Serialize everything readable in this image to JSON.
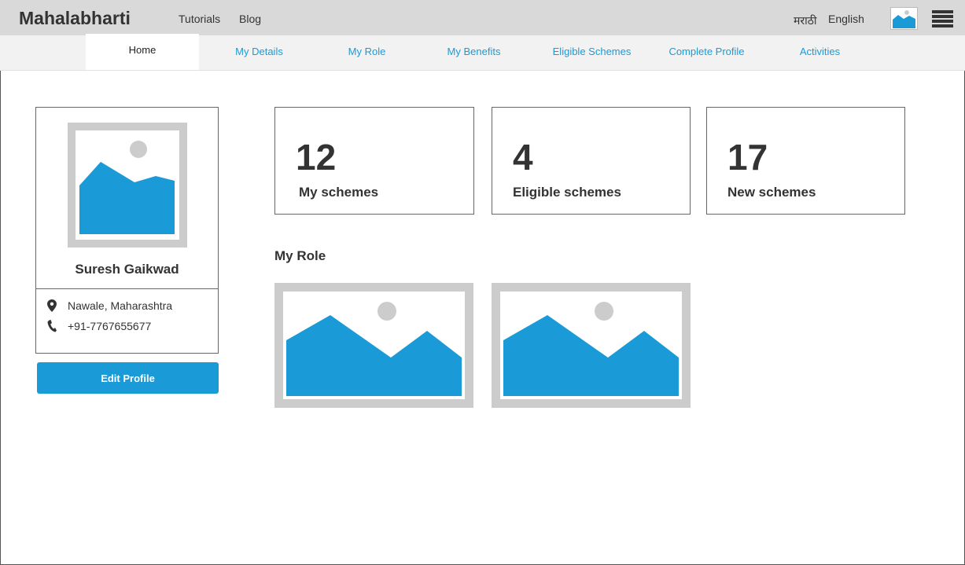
{
  "header": {
    "brand": "Mahalabharti",
    "links": [
      "Tutorials",
      "Blog"
    ],
    "languages": [
      "मराठी",
      "English"
    ],
    "avatar_icon": "image-placeholder-icon",
    "menu_icon": "hamburger-menu-icon"
  },
  "nav": {
    "tabs": [
      "Home",
      "My Details",
      "My Role",
      "My Benefits",
      "Eligible Schemes",
      "Complete Profile",
      "Activities"
    ],
    "active": "Home"
  },
  "profile": {
    "name": "Suresh Gaikwad",
    "location": "Nawale, Maharashtra",
    "phone": "+91-7767655677",
    "location_icon": "map-pin-icon",
    "phone_icon": "phone-icon",
    "edit_label": "Edit Profile"
  },
  "stats": [
    {
      "value": "12",
      "label": "My schemes"
    },
    {
      "value": "4",
      "label": "Eligible schemes"
    },
    {
      "value": "17",
      "label": "New schemes"
    }
  ],
  "role_section": {
    "title": "My Role",
    "items": [
      "image-placeholder-icon",
      "image-placeholder-icon"
    ]
  },
  "colors": {
    "accent": "#1a9bd7",
    "topbar": "#d9d9d9",
    "navbar": "#f2f2f2",
    "placeholder_frame": "#cccccc"
  }
}
